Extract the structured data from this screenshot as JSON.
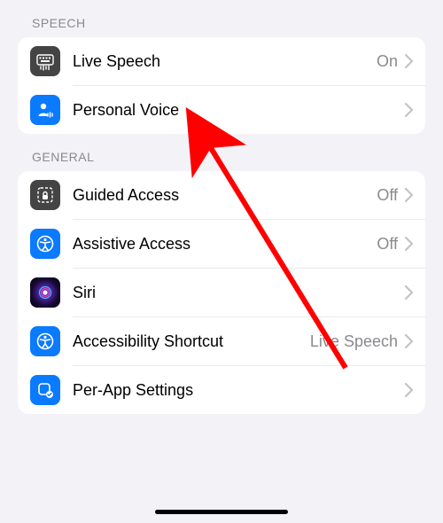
{
  "sections": {
    "speech": {
      "header": "SPEECH",
      "rows": {
        "live_speech": {
          "label": "Live Speech",
          "value": "On"
        },
        "personal_voice": {
          "label": "Personal Voice"
        }
      }
    },
    "general": {
      "header": "GENERAL",
      "rows": {
        "guided_access": {
          "label": "Guided Access",
          "value": "Off"
        },
        "assistive_access": {
          "label": "Assistive Access",
          "value": "Off"
        },
        "siri": {
          "label": "Siri"
        },
        "accessibility_shortcut": {
          "label": "Accessibility Shortcut",
          "value": "Live Speech"
        },
        "per_app": {
          "label": "Per-App Settings"
        }
      }
    }
  },
  "icons": {
    "live_speech": "keyboard-audio-icon",
    "personal_voice": "person-voice-icon",
    "guided_access": "lock-dashed-icon",
    "assistive_access": "accessibility-icon",
    "siri": "siri-icon",
    "accessibility_shortcut": "accessibility-icon",
    "per_app": "app-check-icon"
  },
  "colors": {
    "blue": "#0a7aff",
    "dark": "#444444",
    "chevron": "#c4c4c6"
  }
}
